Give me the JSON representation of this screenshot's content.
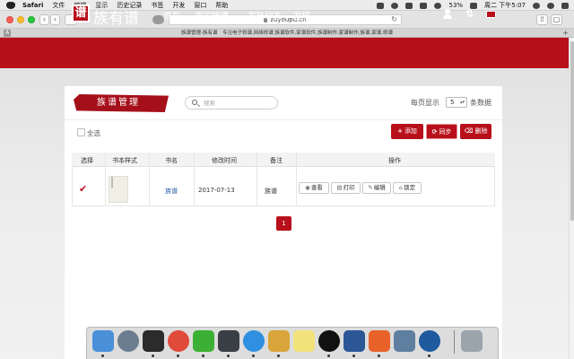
{
  "mac_menu": {
    "items": [
      "Safari",
      "文件",
      "编辑",
      "显示",
      "历史记录",
      "书签",
      "开发",
      "窗口",
      "帮助"
    ],
    "battery": "53%",
    "clock": "周二 下午5:07"
  },
  "browser": {
    "url": "zuyoupu.cn",
    "tab_title": "族谱管理-族有谱　专注电子修谱,网络修谱,族谱软件,家谱软件,族谱制作,家谱制作,族谱,家谱,修谱",
    "back_icon": "‹",
    "forward_icon": "›"
  },
  "site": {
    "logo_mark": "谱",
    "logo_text": "族有谱",
    "nav": {
      "home": "首页",
      "my_genealogy": "我的族谱",
      "family_news": "家族动态",
      "discover": "发现"
    },
    "header_icons": [
      "user-icon",
      "sort-icon",
      "mail-icon"
    ]
  },
  "page": {
    "title": "族谱管理",
    "search_placeholder": "搜索",
    "per_page_prefix": "每页显示",
    "per_page_value": "5",
    "per_page_suffix": "条数据",
    "select_all": "全选",
    "add_button": "添加",
    "sync_button": "同步",
    "delete_button": "删除"
  },
  "table": {
    "headers": {
      "select": "选择",
      "style": "书本样式",
      "name": "书名",
      "modified": "修改时间",
      "note": "备注",
      "actions": "操作"
    },
    "rows": [
      {
        "selected": true,
        "name": "族谱",
        "modified": "2017-07-13",
        "note": "族谱",
        "actions": [
          "查看",
          "打印",
          "编辑",
          "锁定"
        ]
      }
    ]
  },
  "pagination": {
    "current": "1"
  },
  "dock": {
    "apps": [
      "finder-icon",
      "launchpad-icon",
      "terminal-icon",
      "chrome-icon",
      "wechat-icon",
      "sublime-text-icon",
      "safari-icon",
      "database-icon",
      "stickies-icon",
      "qq-icon",
      "word-icon",
      "editor-icon",
      "preview-icon",
      "quicktime-icon",
      "trash-icon"
    ],
    "colors": [
      "#4a90d9",
      "#6b7d8e",
      "#2b2b2b",
      "#e04a3a",
      "#3cb034",
      "#3a3f46",
      "#2f8fe0",
      "#d9a43a",
      "#f2e27a",
      "#111111",
      "#2b5797",
      "#e8622a",
      "#5f7fa0",
      "#1f5a9e",
      "#9aa4ad"
    ]
  },
  "colors": {
    "brand_red": "#b8101b",
    "link_blue": "#2a5aa8"
  }
}
